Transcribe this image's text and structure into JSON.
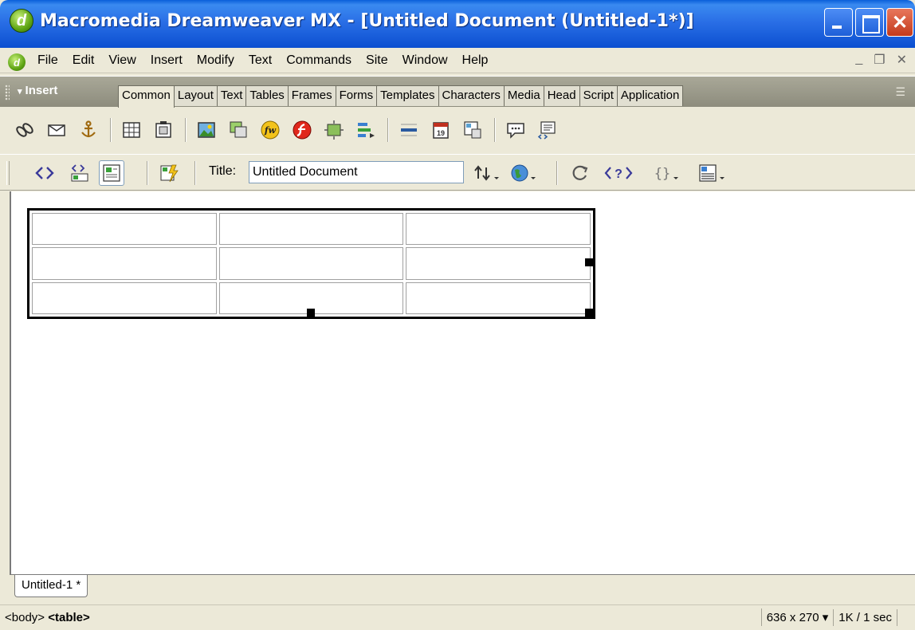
{
  "window": {
    "title": "Macromedia Dreamweaver MX - [Untitled Document (Untitled-1*)]",
    "app_icon": "dreamweaver-logo-icon",
    "app_icon_glyph": "d",
    "minimize_icon": "minimize-icon",
    "maximize_icon": "maximize-icon",
    "close_icon": "close-icon",
    "close_glyph": "✕"
  },
  "menubar": {
    "items": [
      "File",
      "Edit",
      "View",
      "Insert",
      "Modify",
      "Text",
      "Commands",
      "Site",
      "Window",
      "Help"
    ],
    "mdi_controls": [
      "_",
      "❐",
      "✕"
    ]
  },
  "insert_panel": {
    "label": "Insert",
    "arrow": "▾",
    "options_glyph": "☰",
    "tabs": [
      "Common",
      "Layout",
      "Text",
      "Tables",
      "Frames",
      "Forms",
      "Templates",
      "Characters",
      "Media",
      "Head",
      "Script",
      "Application"
    ],
    "active_tab": "Common",
    "buttons": [
      "hyperlink-icon",
      "email-link-icon",
      "named-anchor-icon",
      "table-icon",
      "draw-layer-icon",
      "image-icon",
      "image-placeholder-icon",
      "fireworks-html-icon",
      "flash-icon",
      "rollover-image-icon",
      "navigation-bar-icon",
      "horizontal-rule-icon",
      "date-icon",
      "tabular-data-icon",
      "comment-icon",
      "tag-chooser-icon"
    ]
  },
  "document_toolbar": {
    "title_label": "Title:",
    "title_value": "Untitled Document",
    "buttons": [
      "code-view-icon",
      "split-view-icon",
      "design-view-icon",
      "live-data-icon",
      "file-management-icon",
      "preview-browser-icon",
      "refresh-icon",
      "view-options-icon",
      "braces-icon",
      "design-options-icon"
    ]
  },
  "document": {
    "table": {
      "rows": 3,
      "cols": 3,
      "cells": [
        [
          "",
          "",
          ""
        ],
        [
          "",
          "",
          ""
        ],
        [
          "",
          "",
          ""
        ]
      ]
    }
  },
  "doc_tabs": {
    "active": "Untitled-1 *"
  },
  "statusbar": {
    "tag_body": "<body>",
    "tag_table": "<table>",
    "window_size": "636 x 270",
    "download": "1K / 1 sec"
  },
  "colors": {
    "titlebar": "#2a6fe6",
    "chrome": "#ece9d8",
    "canvas": "#ffffff"
  }
}
